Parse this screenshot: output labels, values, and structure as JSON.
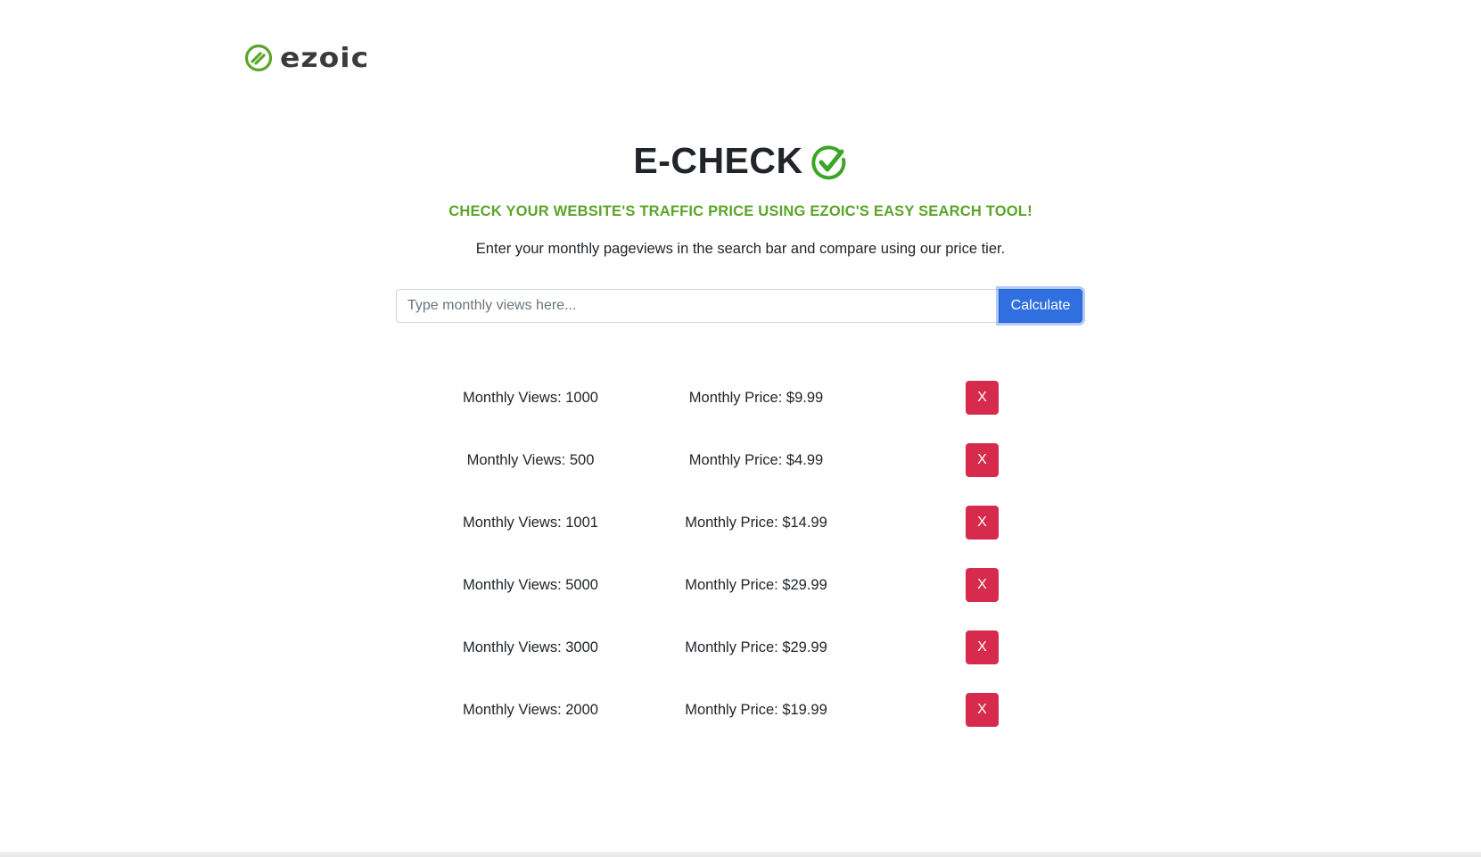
{
  "brand": {
    "logo_text": "ezoic",
    "logo_icon": "ezoic-logo-icon",
    "accent_color": "#5ba52a"
  },
  "header": {
    "title": "E-CHECK",
    "title_icon": "check-circle-icon",
    "subtitle": "CHECK YOUR WEBSITE'S TRAFFIC PRICE USING EZOIC'S EASY SEARCH TOOL!",
    "description": "Enter your monthly pageviews in the search bar and compare using our price tier."
  },
  "search": {
    "placeholder": "Type monthly views here...",
    "value": "",
    "button_label": "Calculate",
    "button_color": "#2f6fdf"
  },
  "results": [
    {
      "views": "Monthly Views: 1000",
      "price": "Monthly Price: $9.99",
      "delete_label": "X"
    },
    {
      "views": "Monthly Views: 500",
      "price": "Monthly Price: $4.99",
      "delete_label": "X"
    },
    {
      "views": "Monthly Views: 1001",
      "price": "Monthly Price: $14.99",
      "delete_label": "X"
    },
    {
      "views": "Monthly Views: 5000",
      "price": "Monthly Price: $29.99",
      "delete_label": "X"
    },
    {
      "views": "Monthly Views: 3000",
      "price": "Monthly Price: $29.99",
      "delete_label": "X"
    },
    {
      "views": "Monthly Views: 2000",
      "price": "Monthly Price: $19.99",
      "delete_label": "X"
    }
  ],
  "delete_color": "#d62b4d"
}
